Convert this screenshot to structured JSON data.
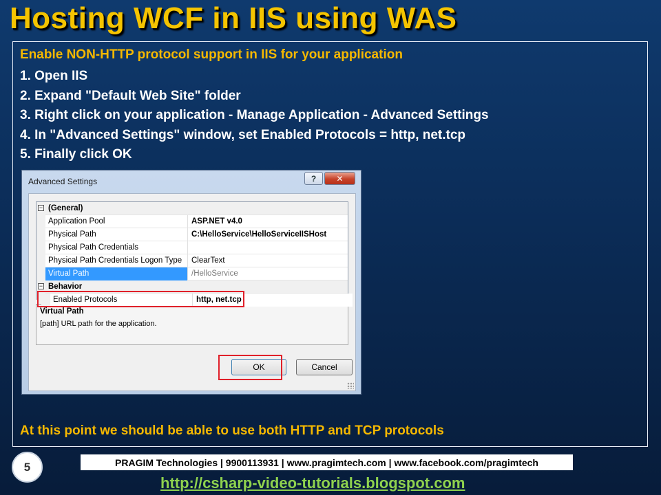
{
  "slide": {
    "title": "Hosting WCF in IIS using WAS",
    "intro": "Enable NON-HTTP protocol support in IIS for your application",
    "steps": [
      "1. Open IIS",
      "2. Expand \"Default Web Site\" folder",
      "3. Right click on your application - Manage Application - Advanced Settings",
      "4. In \"Advanced Settings\" window, set Enabled Protocols = http, net.tcp",
      "5. Finally click OK"
    ],
    "conclusion": "At this point we should be able to use both HTTP and TCP protocols",
    "page_number": "5"
  },
  "dialog": {
    "title": "Advanced Settings",
    "help_label": "?",
    "close_label": "✕",
    "categories": {
      "general": "(General)",
      "behavior": "Behavior"
    },
    "properties": [
      {
        "name": "Application Pool",
        "value": "ASP.NET v4.0"
      },
      {
        "name": "Physical Path",
        "value": "C:\\HelloService\\HelloServiceIISHost"
      },
      {
        "name": "Physical Path Credentials",
        "value": ""
      },
      {
        "name": "Physical Path Credentials Logon Type",
        "value": "ClearText"
      },
      {
        "name": "Virtual Path",
        "value": "/HelloService"
      }
    ],
    "behavior_properties": [
      {
        "name": "Enabled Protocols",
        "value": "http, net.tcp"
      }
    ],
    "description": {
      "title": "Virtual Path",
      "text": "[path] URL path for the application."
    },
    "ok_label": "OK",
    "cancel_label": "Cancel"
  },
  "footer": {
    "company": "PRAGIM Technologies | 9900113931 | www.pragimtech.com | www.facebook.com/pragimtech",
    "url": "http://csharp-video-tutorials.blogspot.com"
  }
}
